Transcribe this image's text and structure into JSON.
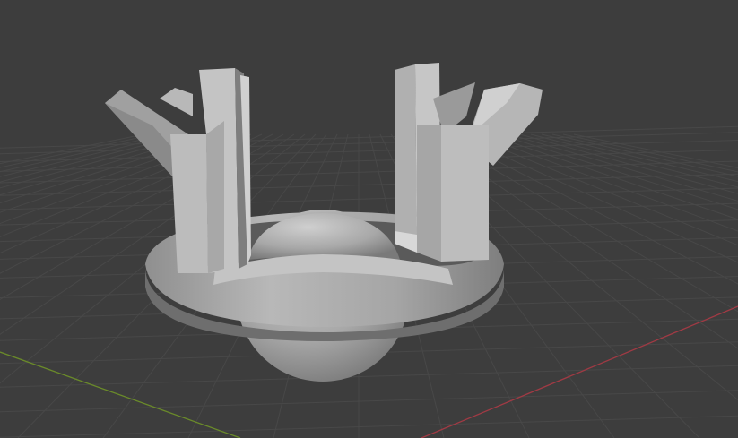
{
  "viewport": {
    "background_color": "#3d3d3d",
    "grid_color": "#484848",
    "x_axis_color": "#a03a44",
    "y_axis_color": "#6a8a2a",
    "model_color": "#b4b4b4"
  }
}
